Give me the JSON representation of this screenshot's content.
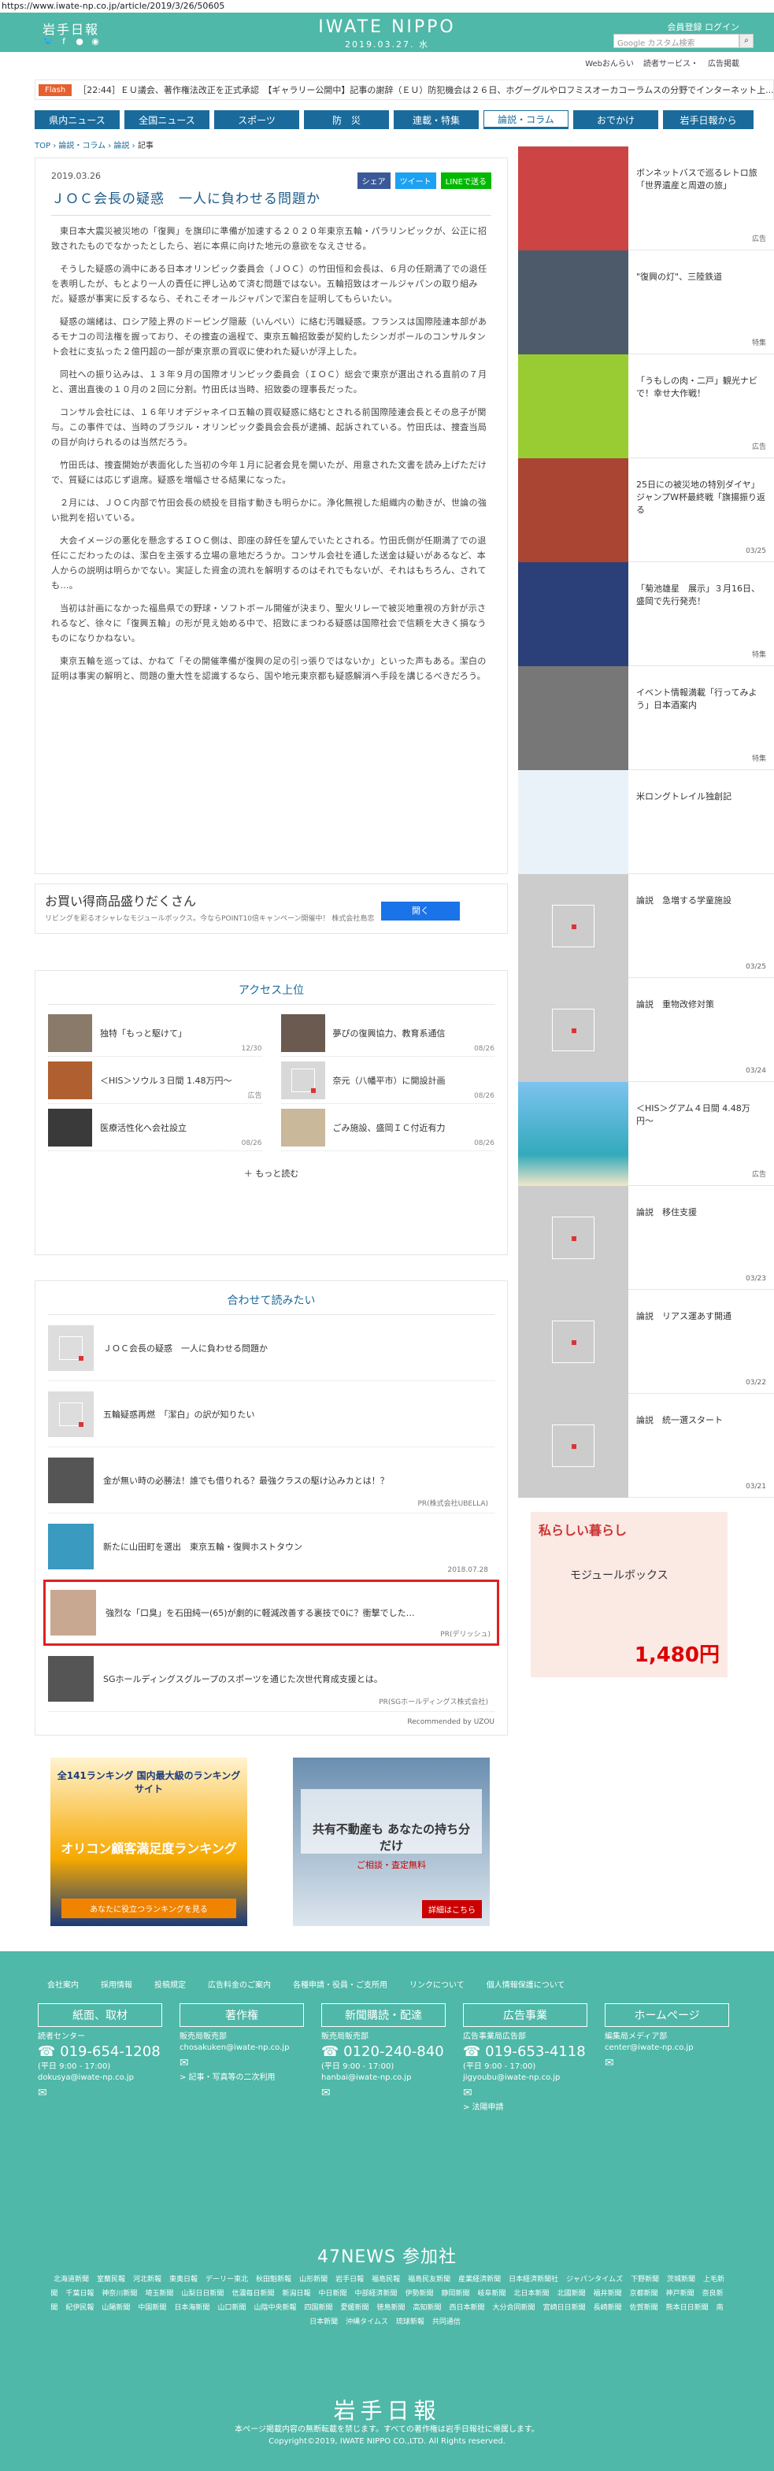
{
  "url": "https://www.iwate-np.co.jp/article/2019/3/26/50605",
  "header": {
    "small_logo": "岩手日報",
    "logo": "IWATE NIPPO",
    "date": "2019.03.27. 水",
    "member_links": "会員登録 ログイン",
    "search_placeholder": "Google カスタム検索",
    "sublinks": [
      "Webおんらい",
      "読者サービス・",
      "広告掲載 "
    ]
  },
  "flash": {
    "tag": "Flash",
    "items": "［22:44］ＥＵ議会、著作権法改正を正式承認　【ギャラリー公開中】記事の謝辞（ＥＵ）防犯機会は２６日、ホグーグルやロフミスオーカコーラムスの分野でインターネット上...",
    "time": "［22:44］"
  },
  "nav": [
    "県内ニュース",
    "全国ニュース",
    "スポーツ",
    "防　災",
    "連載・特集",
    "論説・コラム",
    "おでかけ",
    "岩手日報から"
  ],
  "breadcrumb": {
    "top": "TOP",
    "sep1": "›",
    "l1": "論説・コラム",
    "sep2": "›",
    "l2": "論説",
    "sep3": "›",
    "current": "記事"
  },
  "article": {
    "date": "2019.03.26",
    "share": [
      "シェア",
      "ツイート",
      "LINEで送る"
    ],
    "title": "ＪＯＣ会長の疑惑　一人に負わせる問題か",
    "paragraphs": [
      "東日本大震災被災地の「復興」を旗印に準備が加速する２０２０年東京五輪・パラリンピックが、公正に招致されたものでなかったとしたら、岩に本県に向けた地元の意欲をなえさせる。",
      "そうした疑惑の渦中にある日本オリンピック委員会（ＪＯＣ）の竹田恒和会長は、６月の任期満了での退任を表明したが、もとより一人の責任に押し込めて済む問題ではない。五輪招致はオールジャパンの取り組みだ。疑惑が事実に反するなら、それこそオールジャパンで潔白を証明してもらいたい。",
      "疑惑の端緒は、ロシア陸上界のドーピング隠蔽（いんぺい）に絡む汚職疑惑。フランスは国際陸連本部があるモナコの司法権を握っており、その捜査の過程で、東京五輪招致委が契約したシンガポールのコンサルタント会社に支払った２億円超の一部が東京票の買収に使われた疑いが浮上した。",
      "同社への振り込みは、１３年９月の国際オリンピック委員会（ＩＯＣ）総会で東京が選出される直前の７月と、選出直後の１０月の２回に分割。竹田氏は当時、招致委の理事長だった。",
      "コンサル会社には、１６年リオデジャネイロ五輪の買収疑惑に絡むとされる前国際陸連会長とその息子が関与。この事件では、当時のブラジル・オリンピック委員会会長が逮捕、起訴されている。竹田氏は、捜査当局の目が向けられるのは当然だろう。",
      "竹田氏は、捜査開始が表面化した当初の今年１月に記者会見を開いたが、用意された文書を読み上げただけで、質疑には応じず退席。疑惑を増幅させる結果になった。",
      "２月には、ＪＯＣ内部で竹田会長の続投を目指す動きも明らかに。浄化無視した組織内の動きが、世論の強い批判を招いている。",
      "大会イメージの悪化を懸念するＩＯＣ側は、即座の辞任を望んでいたとされる。竹田氏側が任期満了での退任にこだわったのは、潔白を主張する立場の意地だろうか。コンサル会社を通した送金は疑いがあるなど、本人からの説明は明らかでない。実証した資金の流れを解明するのはそれでもないが、それはもちろん、されても...。",
      "当初は計画になかった福島県での野球・ソフトボール開催が決まり、聖火リレーで被災地重視の方針が示されるなど、徐々に「復興五輪」の形が見え始める中で、招致にまつわる疑惑は国際社会で信頼を大きく損なうものになりかねない。",
      "東京五輪を巡っては、かねて「その開催準備が復興の足の引っ張りではないか」といった声もある。潔白の証明は事実の解明と、問題の重大性を認識するなら、国や地元東京都も疑惑解消へ手段を講じるべきだろう。"
    ]
  },
  "inline_ad": {
    "title": "お買い得商品盛りだくさん",
    "sub": "リビングを彩るオシャレなモジュールボックス。今ならPOINT10倍キャンペーン開催中！ 株式会社島忠",
    "button": "開く"
  },
  "ranking": {
    "title": "アクセス上位",
    "items": [
      {
        "text": "独特「もっと駆けて」",
        "date": "12/30"
      },
      {
        "text": "夢ぴの復興協力、教育系通信",
        "date": "08/26"
      },
      {
        "text": "＜HIS＞ソウル３日間 1.48万円〜",
        "date": "広告"
      },
      {
        "text": "奈元（八幡平市）に開設計画",
        "date": "08/26"
      },
      {
        "text": "医療活性化へ会社設立",
        "date": "08/26"
      },
      {
        "text": "ごみ施設、盛岡ＩＣ付近有力",
        "date": "08/26"
      }
    ],
    "more": "もっと読む"
  },
  "related": {
    "title": "合わせて読みたい",
    "items": [
      {
        "text": "ＪＯＣ会長の疑惑　一人に負わせる問題か",
        "src": ""
      },
      {
        "text": "五輪疑惑再燃　「潔白」の訳が知りたい",
        "src": ""
      },
      {
        "text": "金が無い時の必勝法！誰でも借りれる？最強クラスの駆け込みカとは！？",
        "src": "PR(株式会社UBELLA)"
      },
      {
        "text": "新たに山田町を選出　東京五輪・復興ホストタウン",
        "src": "2018.07.28"
      },
      {
        "text": "強烈な「口臭」を石田純一(65)が劇的に軽減改善する裏技で0に？衝撃でした…",
        "src": "PR(デリッシュ)"
      },
      {
        "text": "SGホールディングスグループのスポーツを通じた次世代育成支援とは。",
        "src": "PR(SGホールディングス株式会社)"
      }
    ],
    "recommend": "Recommended by UZOU"
  },
  "bottom_ads": [
    {
      "title": "全141ランキング 国内最大級のランキングサイト",
      "sub": "オリコン顧客満足度ランキング",
      "btn": "あなたに役立つランキングを見る"
    },
    {
      "title": "共有不動産も あなたの持ち分だけ",
      "sub": "ご相談・査定無料",
      "btn": "詳細はこちら"
    }
  ],
  "sidebar": [
    {
      "text": "ボンネットバスで巡るレトロ旅「世界遺産と周遊の旅」",
      "cat": "広告",
      "img": "#c44"
    },
    {
      "text": "\"復興の灯\"、三陸鉄道",
      "cat": "特集",
      "img": "#555"
    },
    {
      "text": "「うもしの肉・二戸」観光ナビで！幸せ大作戦！",
      "cat": "広告",
      "img": "#9c3"
    },
    {
      "text": "25日にの被災地の特別ダイヤ」ジャンプW杯最終戦「旗揚振り返る",
      "cat": "03/25",
      "img": "#a43"
    },
    {
      "text": "「菊池雄星　展示」３月16日、盛岡で先行発売！",
      "cat": "特集",
      "img": "#34a"
    },
    {
      "text": "イベント情報満載「行ってみよう」日本酒案内",
      "cat": "特集",
      "img": "#777"
    },
    {
      "text": "米ロングトレイル独創記",
      "cat": "",
      "img": "#fff"
    },
    {
      "text": "論説　急増する学童施設",
      "cat": "03/25",
      "img": ""
    },
    {
      "text": "論説　重物改修対策",
      "cat": "03/24",
      "img": ""
    },
    {
      "text": "＜HIS＞グアム４日間 4.48万円〜",
      "cat": "広告",
      "img": "#3ab"
    },
    {
      "text": "論説　移住支援",
      "cat": "03/23",
      "img": ""
    },
    {
      "text": "論説　リアス運あす開通",
      "cat": "03/22",
      "img": ""
    },
    {
      "text": "論説　統一選スタート",
      "cat": "03/21",
      "img": ""
    }
  ],
  "side_ad": {
    "title": "私らしい暮らし",
    "product": "モジュールボックス",
    "price": "1,480円"
  },
  "footer": {
    "links": [
      "会社案内",
      "採用情報",
      "投稿規定",
      "広告料金のご案内",
      "各種申請・役員・ご支所用",
      "リンクについて",
      "個人情報保護について"
    ],
    "cols": [
      {
        "h": "紙面、取材",
        "a": "読者センター",
        "tel": "019-654-1208",
        "time": "(平日 9:00 - 17:00)",
        "mail": "dokusya@iwate-np.co.jp"
      },
      {
        "h": "著作権",
        "a": "販売局販売部",
        "tel": "",
        "time": "",
        "mail": "chosakuken@iwate-np.co.jp",
        "note": "> 記事・写真等の二次利用"
      },
      {
        "h": "新聞購読・配達",
        "a": "販売局販売部",
        "tel": "0120-240-840",
        "time": "(平日 9:00 - 17:00)",
        "mail": "hanbai@iwate-np.co.jp"
      },
      {
        "h": "広告事業",
        "a": "広告事業局広告部",
        "tel": "019-653-4118",
        "time": "(平日 9:00 - 17:00)",
        "mail": "jigyoubu@iwate-np.co.jp",
        "note": "> 法陽申請"
      },
      {
        "h": "ホームページ",
        "a": "編集局メディア部",
        "tel": "",
        "time": "",
        "mail": "center@iwate-np.co.jp"
      }
    ],
    "n47": "47NEWS 参加社",
    "papers": [
      "北海道新聞",
      "室蘭民報",
      "河北新報",
      "東奥日報",
      "デーリー東北",
      "秋田魁新報",
      "山形新聞",
      "岩手日報",
      "福島民報",
      "福島民友新聞",
      "産業経済新聞",
      "日本経済新聞社",
      "ジャパンタイムズ",
      "下野新聞",
      "茨城新聞",
      "上毛新聞",
      "千葉日報",
      "神奈川新聞",
      "埼玉新聞",
      "山梨日日新聞",
      "信濃毎日新聞",
      "新潟日報",
      "中日新聞",
      "中部経済新聞",
      "伊勢新聞",
      "静岡新聞",
      "岐阜新聞",
      "北日本新聞",
      "北國新聞",
      "福井新聞",
      "京都新聞",
      "神戸新聞",
      "奈良新聞",
      "紀伊民報",
      "山陽新聞",
      "中国新聞",
      "日本海新聞",
      "山口新聞",
      "山陰中央新報",
      "四国新聞",
      "愛媛新聞",
      "徳島新聞",
      "高知新聞",
      "西日本新聞",
      "大分合同新聞",
      "宮崎日日新聞",
      "長崎新聞",
      "佐賀新聞",
      "熊本日日新聞",
      "南日本新聞",
      "沖縄タイムス",
      "琉球新報",
      "共同通信"
    ],
    "logo": "岩手日報",
    "copy1": "本ページ掲載内容の無断転載を禁じます。すべての著作権は岩手日報社に帰属します。",
    "copy2": "Copyright©2019, IWATE NIPPO CO.,LTD. All Rights reserved."
  },
  "colors": {
    "teal": "#4fb8a8",
    "navy": "#1a6b9c",
    "flash": "#e5602e",
    "highlight": "#e02020"
  }
}
